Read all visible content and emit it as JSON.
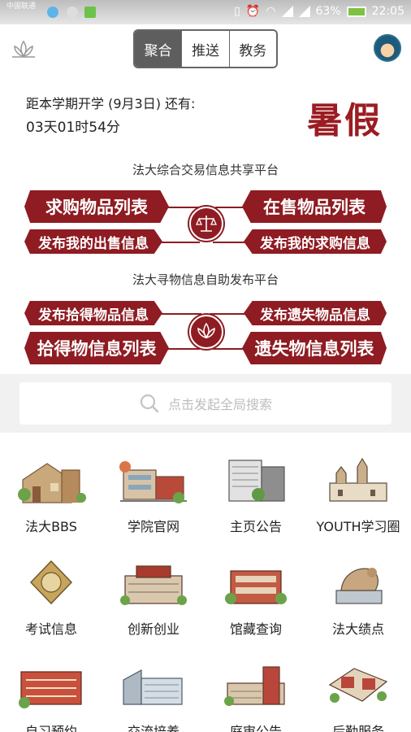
{
  "status_bar": {
    "carrier": "中国联通",
    "battery": "63%",
    "time": "22:05"
  },
  "header": {
    "tabs": [
      {
        "label": "聚合",
        "active": true
      },
      {
        "label": "推送",
        "active": false
      },
      {
        "label": "教务",
        "active": false
      }
    ]
  },
  "countdown": {
    "label": "距本学期开学 (9月3日) 还有:",
    "value": "03天01时54分",
    "season": "暑假"
  },
  "trade_platform": {
    "title": "法大综合交易信息共享平台",
    "buttons": [
      "求购物品列表",
      "在售物品列表",
      "发布我的出售信息",
      "发布我的求购信息"
    ]
  },
  "lost_found_platform": {
    "title": "法大寻物信息自助发布平台",
    "buttons": [
      "发布拾得物品信息",
      "发布遗失物品信息",
      "拾得物信息列表",
      "遗失物信息列表"
    ]
  },
  "search": {
    "placeholder": "点击发起全局搜索"
  },
  "grid": [
    {
      "label": "法大BBS",
      "icon": "bbs-building-icon"
    },
    {
      "label": "学院官网",
      "icon": "college-building-icon"
    },
    {
      "label": "主页公告",
      "icon": "announcement-building-icon"
    },
    {
      "label": "YOUTH学习圈",
      "icon": "youth-castle-icon"
    },
    {
      "label": "考试信息",
      "icon": "exam-medal-icon"
    },
    {
      "label": "创新创业",
      "icon": "innovation-building-icon"
    },
    {
      "label": "馆藏查询",
      "icon": "library-building-icon"
    },
    {
      "label": "法大绩点",
      "icon": "statue-icon"
    },
    {
      "label": "自习预约",
      "icon": "study-building-icon"
    },
    {
      "label": "交流培养",
      "icon": "exchange-building-icon"
    },
    {
      "label": "庭审公告",
      "icon": "court-building-icon"
    },
    {
      "label": "后勤服务",
      "icon": "logistics-campus-icon"
    }
  ],
  "colors": {
    "accent": "#8e1c22",
    "segment_active": "#5e5e5e"
  }
}
